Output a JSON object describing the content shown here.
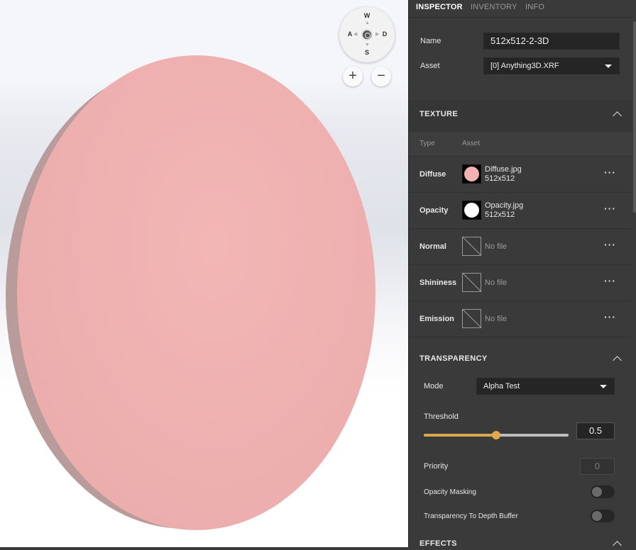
{
  "navigation": {
    "keys": {
      "up": "W",
      "left": "A",
      "right": "D",
      "down": "S"
    },
    "zoom_in": "+",
    "zoom_out": "−"
  },
  "tabs": [
    {
      "label": "INSPECTOR",
      "active": true
    },
    {
      "label": "INVENTORY",
      "active": false
    },
    {
      "label": "INFO",
      "active": false
    }
  ],
  "object": {
    "name_label": "Name",
    "name_value": "512x512-2-3D",
    "asset_label": "Asset",
    "asset_value": "[0] Anything3D.XRF"
  },
  "texture": {
    "title": "TEXTURE",
    "col_type": "Type",
    "col_asset": "Asset",
    "rows": [
      {
        "type": "Diffuse",
        "file": "Diffuse.jpg",
        "size": "512x512",
        "swatch": "#f2b2b2"
      },
      {
        "type": "Opacity",
        "file": "Opacity.jpg",
        "size": "512x512",
        "swatch": "#ffffff"
      },
      {
        "type": "Normal",
        "empty_text": "No file"
      },
      {
        "type": "Shininess",
        "empty_text": "No file"
      },
      {
        "type": "Emission",
        "empty_text": "No file"
      }
    ],
    "more_glyph": "···"
  },
  "transparency": {
    "title": "TRANSPARENCY",
    "mode_label": "Mode",
    "mode_value": "Alpha Test",
    "threshold_label": "Threshold",
    "threshold_value": "0.5",
    "threshold_fraction": 0.5,
    "priority_label": "Priority",
    "priority_value": "0",
    "opacity_masking_label": "Opacity Masking",
    "opacity_masking_on": false,
    "depth_buffer_label": "Transparency To Depth Buffer",
    "depth_buffer_on": false
  },
  "effects": {
    "title": "EFFECTS"
  },
  "colors": {
    "disc_face": "#eeb1b0",
    "panel_bg": "#3a3a3a",
    "slider_accent": "#d9a84e"
  }
}
